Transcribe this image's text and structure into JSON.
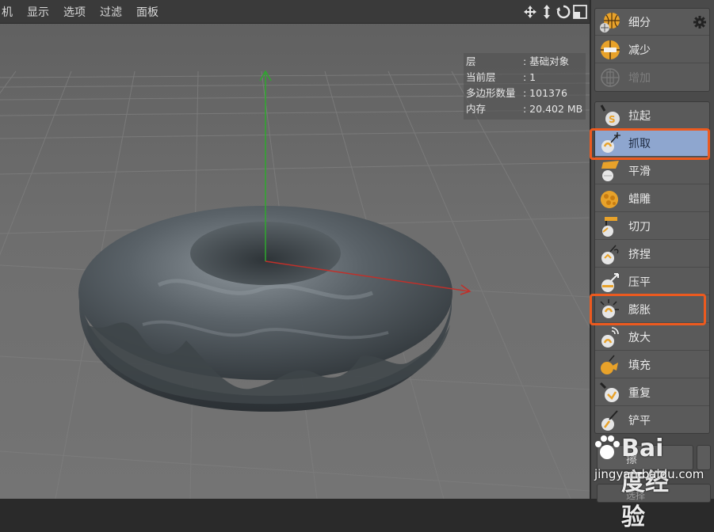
{
  "menubar": {
    "items": [
      "机",
      "显示",
      "选项",
      "过滤",
      "面板"
    ]
  },
  "nav_icons": [
    "move-view-icon",
    "dolly-view-icon",
    "rotate-view-icon",
    "maximize-view-icon"
  ],
  "info_panel": {
    "rows": [
      {
        "label": "层",
        "value": ": 基础对象"
      },
      {
        "label": "当前层",
        "value": ": 1"
      },
      {
        "label": "多边形数量",
        "value": ": 101376"
      },
      {
        "label": "内存",
        "value": ": 20.402 MB"
      }
    ]
  },
  "tools": {
    "top_group": [
      {
        "label": "细分",
        "icon": "subdivide-icon"
      },
      {
        "label": "减少",
        "icon": "decrease-icon"
      },
      {
        "label": "增加",
        "icon": "increase-icon",
        "disabled": true
      }
    ],
    "brushes": [
      {
        "label": "拉起",
        "icon": "pull-brush-icon"
      },
      {
        "label": "抓取",
        "icon": "grab-brush-icon",
        "selected": true
      },
      {
        "label": "平滑",
        "icon": "smooth-brush-icon"
      },
      {
        "label": "蜡雕",
        "icon": "wax-brush-icon"
      },
      {
        "label": "切刀",
        "icon": "knife-brush-icon"
      },
      {
        "label": "挤捏",
        "icon": "pinch-brush-icon"
      },
      {
        "label": "压平",
        "icon": "flatten-brush-icon"
      },
      {
        "label": "膨胀",
        "icon": "inflate-brush-icon"
      },
      {
        "label": "放大",
        "icon": "amplify-brush-icon"
      },
      {
        "label": "填充",
        "icon": "fill-brush-icon"
      },
      {
        "label": "重复",
        "icon": "repeat-brush-icon"
      },
      {
        "label": "铲平",
        "icon": "scrape-brush-icon"
      }
    ],
    "bottom_label": "擦",
    "bottom_label_2": "选择"
  },
  "watermark": {
    "text": "Bai度经验",
    "url": "jingyan.baidu.com"
  },
  "colors": {
    "selected": "#8ea6cf",
    "highlight": "#ec5a1f",
    "panel": "#4a4a4a",
    "viewport": "#6e6e6e"
  }
}
